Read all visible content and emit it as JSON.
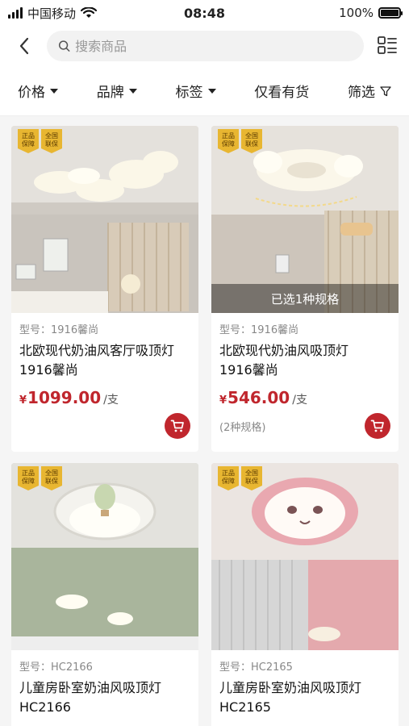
{
  "status_bar": {
    "carrier": "中国移动",
    "time": "08:48",
    "battery": "100%",
    "battery_level": 1.0
  },
  "header": {
    "search_placeholder": "搜索商品"
  },
  "filters": [
    {
      "label": "价格",
      "has_caret": true
    },
    {
      "label": "品牌",
      "has_caret": true
    },
    {
      "label": "标签",
      "has_caret": true
    },
    {
      "label": "仅看有货",
      "has_caret": false
    },
    {
      "label": "筛选",
      "has_caret": false
    }
  ],
  "colors": {
    "accent": "#c0262d",
    "badge": "#e8b631"
  },
  "badges": [
    "正品\n保障",
    "全国\n联保"
  ],
  "products": [
    {
      "model": "型号：1916馨尚",
      "title_line1": "北欧现代奶油风客厅吸顶灯",
      "title_line2": "1916馨尚",
      "currency": "¥",
      "price": "1099.00",
      "unit": "/支",
      "spec_overlay": "",
      "spec_count": ""
    },
    {
      "model": "型号：1916馨尚",
      "title_line1": "北欧现代奶油风吸顶灯",
      "title_line2": "1916馨尚",
      "currency": "¥",
      "price": "546.00",
      "unit": "/支",
      "spec_overlay": "已选1种规格",
      "spec_count": "(2种规格)"
    },
    {
      "model": "型号：HC2166",
      "title_line1": "儿童房卧室奶油风吸顶灯",
      "title_line2": "HC2166",
      "currency": "¥",
      "price": "",
      "unit": "",
      "spec_overlay": "",
      "spec_count": ""
    },
    {
      "model": "型号：HC2165",
      "title_line1": "儿童房卧室奶油风吸顶灯",
      "title_line2": "HC2165",
      "currency": "¥",
      "price": "",
      "unit": "",
      "spec_overlay": "",
      "spec_count": ""
    }
  ]
}
